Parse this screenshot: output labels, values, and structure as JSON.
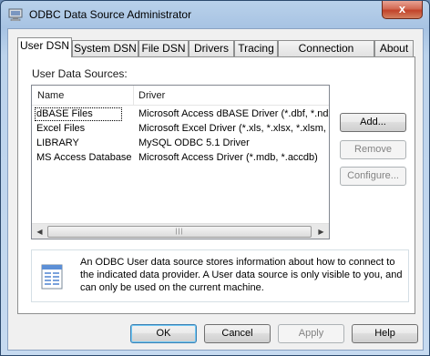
{
  "window": {
    "title": "ODBC Data Source Administrator",
    "close_label": "x"
  },
  "tabs": [
    {
      "label": "User DSN",
      "active": true
    },
    {
      "label": "System DSN",
      "active": false
    },
    {
      "label": "File DSN",
      "active": false
    },
    {
      "label": "Drivers",
      "active": false
    },
    {
      "label": "Tracing",
      "active": false
    },
    {
      "label": "Connection Pooling",
      "active": false
    },
    {
      "label": "About",
      "active": false
    }
  ],
  "user_dsn": {
    "section_label": "User Data Sources:",
    "columns": [
      "Name",
      "Driver"
    ],
    "rows": [
      {
        "name": "dBASE Files",
        "driver": "Microsoft Access dBASE Driver (*.dbf, *.ndx"
      },
      {
        "name": "Excel Files",
        "driver": "Microsoft Excel Driver (*.xls, *.xlsx, *.xlsm, *.x"
      },
      {
        "name": "LIBRARY",
        "driver": "MySQL ODBC 5.1 Driver"
      },
      {
        "name": "MS Access Database",
        "driver": "Microsoft Access Driver (*.mdb, *.accdb)"
      }
    ],
    "buttons": {
      "add": "Add...",
      "remove": "Remove",
      "configure": "Configure..."
    },
    "info_text": "An ODBC User data source stores information about how to connect to the indicated data provider.   A User data source is only visible to you, and can only be used on the current machine."
  },
  "footer": {
    "ok": "OK",
    "cancel": "Cancel",
    "apply": "Apply",
    "help": "Help"
  },
  "icons": {
    "title": "odbc-computer-icon",
    "info": "database-document-icon"
  },
  "colors": {
    "title_gradient": "#b9d1ea",
    "close_red": "#c2432a",
    "focus_blue": "#3c7fb1"
  }
}
